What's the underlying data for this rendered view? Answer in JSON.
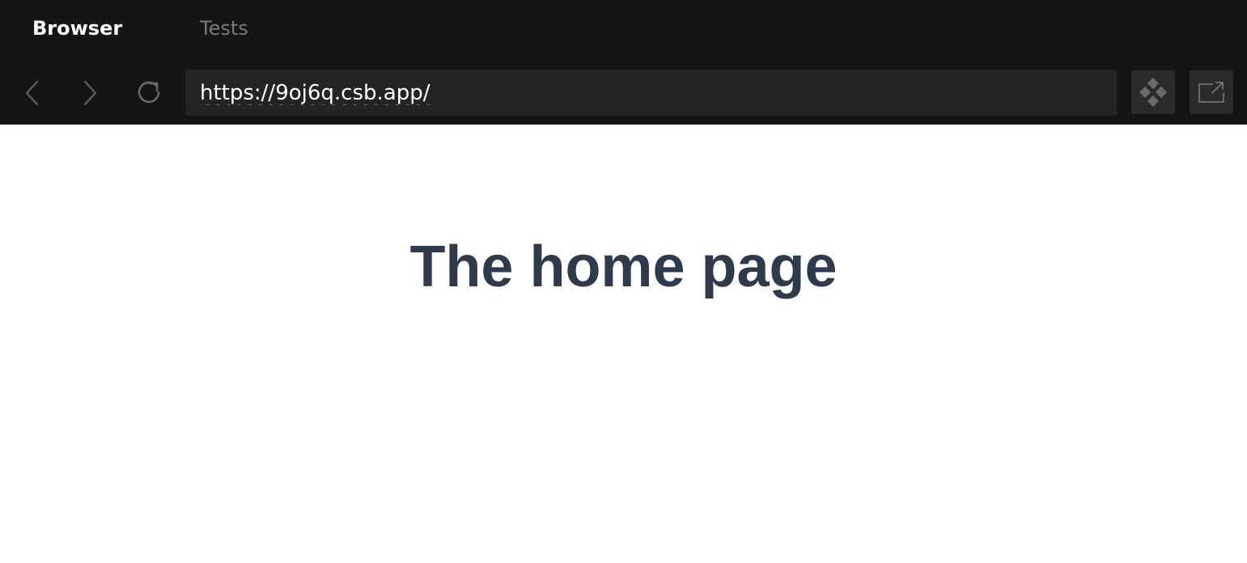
{
  "tabs": [
    {
      "label": "Browser",
      "active": true
    },
    {
      "label": "Tests",
      "active": false
    }
  ],
  "navigation": {
    "back_icon": "chevron-left-icon",
    "forward_icon": "chevron-right-icon",
    "refresh_icon": "refresh-icon"
  },
  "address_bar": {
    "value": "https://9oj6q.csb.app/"
  },
  "toolbar": {
    "devtools_icon": "diamond-cluster-icon",
    "open_external_icon": "open-external-icon"
  },
  "page": {
    "heading": "The home page"
  },
  "colors": {
    "chrome_background": "#151515",
    "address_background": "#242424",
    "heading_color": "#2f3a4c"
  }
}
